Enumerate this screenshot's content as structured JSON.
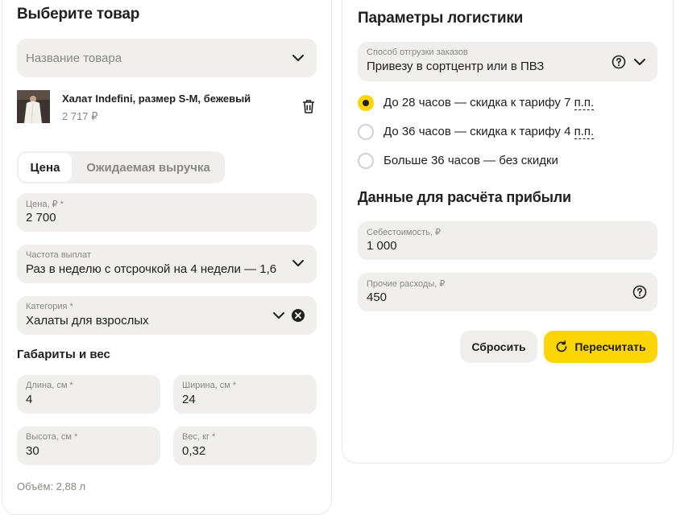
{
  "product_section": {
    "title": "Выберите товар",
    "product_select": {
      "placeholder": "Название товара"
    },
    "selected_product": {
      "name": "Халат Indefini, размер S-M, бежевый",
      "price": "2 717 ₽"
    },
    "tabs": [
      {
        "label": "Цена",
        "active": true
      },
      {
        "label": "Ожидаемая выручка",
        "active": false
      }
    ],
    "price_field": {
      "label": "Цена, ₽ *",
      "value": "2 700"
    },
    "payout_field": {
      "label": "Частота выплат",
      "value": "Раз в неделю с отсрочкой на 4 недели — 1,6"
    },
    "category_field": {
      "label": "Категория *",
      "value": "Халаты для взрослых"
    },
    "dimensions": {
      "title": "Габариты и вес",
      "length": {
        "label": "Длина, см *",
        "value": "4"
      },
      "width": {
        "label": "Ширина, см *",
        "value": "24"
      },
      "height": {
        "label": "Высота, см *",
        "value": "30"
      },
      "weight": {
        "label": "Вес, кг *",
        "value": "0,32"
      },
      "volume": "Объём: 2,88 л"
    }
  },
  "logistics_section": {
    "title": "Параметры логистики",
    "shipping_field": {
      "label": "Способ отгрузки заказов",
      "value": "Привезу в сортцентр или в ПВЗ"
    },
    "options": [
      {
        "text": "До 28 часов — скидка к тарифу 7 ",
        "unit": "п.п.",
        "selected": true
      },
      {
        "text": "До 36 часов — скидка к тарифу 4 ",
        "unit": "п.п.",
        "selected": false
      },
      {
        "text": "Больше 36 часов — без скидки",
        "unit": "",
        "selected": false
      }
    ]
  },
  "profit_section": {
    "title": "Данные для расчёта прибыли",
    "cost_field": {
      "label": "Себестоимость, ₽",
      "value": "1 000"
    },
    "other_field": {
      "label": "Прочие расходы, ₽",
      "value": "450"
    },
    "reset_button": "Сбросить",
    "recalc_button": "Пересчитать"
  },
  "colors": {
    "accent": "#fcd506",
    "field_bg": "#f0efed",
    "muted_text": "#8a8784"
  },
  "icons": [
    "chevron-down-icon",
    "trash-icon",
    "clear-icon",
    "help-icon",
    "refresh-icon"
  ]
}
